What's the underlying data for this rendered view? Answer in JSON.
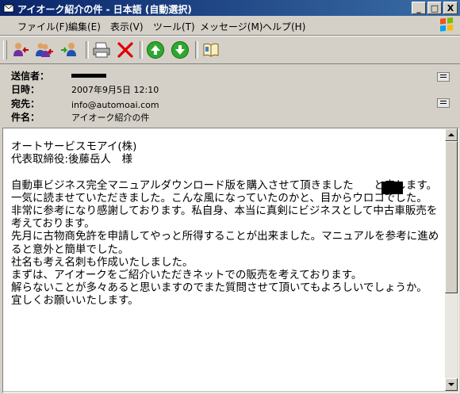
{
  "window": {
    "title": "アイオーク紹介の件 - 日本語 (自動選択)",
    "controls": {
      "minimize": "_",
      "maximize": "□",
      "close": "X"
    }
  },
  "menu": [
    "ファイル(F)",
    "編集(E)",
    "表示(V)",
    "ツール(T)",
    "メッセージ(M)",
    "ヘルプ(H)"
  ],
  "toolbar": {
    "icons": [
      "reply-icon",
      "reply-all-icon",
      "forward-icon",
      "print-icon",
      "delete-icon",
      "previous-icon",
      "next-icon",
      "address-book-icon"
    ]
  },
  "header": {
    "from_label": "送信者：",
    "date_label": "日時：",
    "date_value": "2007年9月5日 12:10",
    "to_label": "宛先：",
    "to_value": "info@automoai.com",
    "subject_label": "件名：",
    "subject_value": "アイオーク紹介の件"
  },
  "body": {
    "text": "オートサービスモアイ(株)\n代表取締役:後藤岳人　様\n\n自動車ビジネス完全マニュアルダウンロード版を購入させて頂きました      と申します。\n一気に読ませていただきました。こんな風になっていたのかと、目からウロコでした。\n非常に参考になり感謝しております。私自身、本当に真剣にビジネスとして中古車販売を考えております。\n先月に古物商免許を申請してやっと所得することが出来ました。マニュアルを参考に進めると意外と簡単でした。\n社名も考え名刺も作成いたしました。\nまずは、アイオークをご紹介いただきネットでの販売を考えております。\n解らないことが多々あると思いますのでまた質問させて頂いてもよろしいでしょうか。\n宜しくお願いいたします。"
  },
  "colors": {
    "title_start": "#0a246a",
    "title_end": "#3a6ea5",
    "chrome": "#d4d0c8"
  }
}
